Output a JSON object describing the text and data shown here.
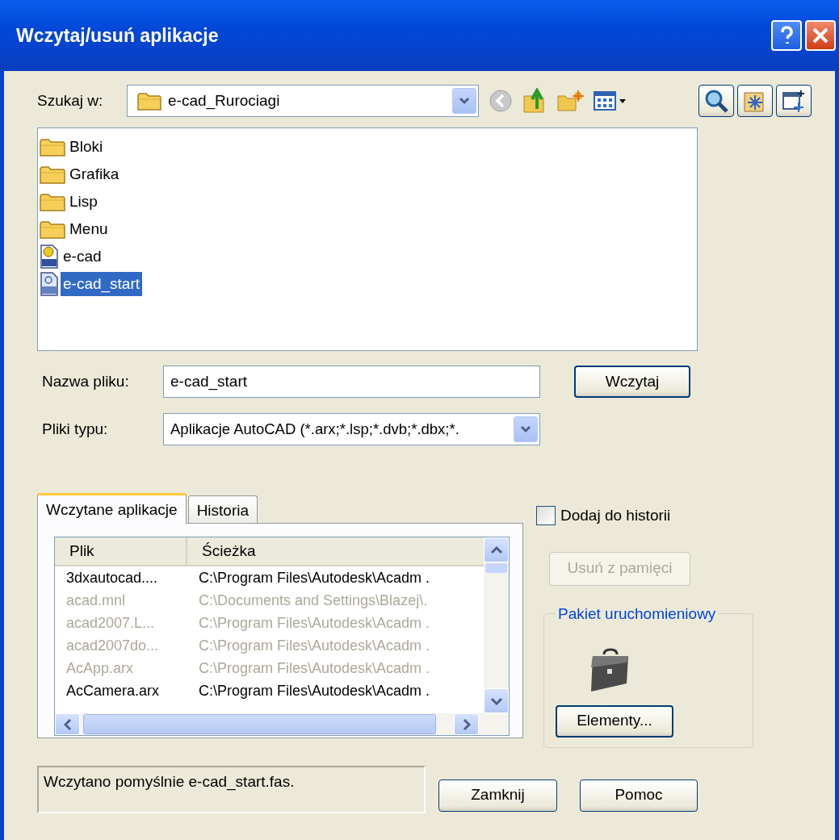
{
  "window": {
    "title": "Wczytaj/usuń aplikacje"
  },
  "look_in": {
    "label": "Szukaj w:",
    "value": "e-cad_Rurociagi"
  },
  "files": [
    {
      "name": "Bloki",
      "kind": "folder",
      "selected": false
    },
    {
      "name": "Grafika",
      "kind": "folder",
      "selected": false
    },
    {
      "name": "Lisp",
      "kind": "folder",
      "selected": false
    },
    {
      "name": "Menu",
      "kind": "folder",
      "selected": false
    },
    {
      "name": "e-cad",
      "kind": "dvb",
      "selected": false
    },
    {
      "name": "e-cad_start",
      "kind": "fas",
      "selected": true
    }
  ],
  "file_name": {
    "label": "Nazwa pliku:",
    "value": "e-cad_start"
  },
  "load_button": "Wczytaj",
  "file_type": {
    "label": "Pliki typu:",
    "value": "Aplikacje AutoCAD (*.arx;*.lsp;*.dvb;*.dbx;*."
  },
  "tabs": [
    {
      "label": "Wczytane aplikacje",
      "selected": true
    },
    {
      "label": "Historia",
      "selected": false
    }
  ],
  "table": {
    "columns": [
      "Plik",
      "Ścieżka"
    ],
    "rows": [
      {
        "file": "3dxautocad....",
        "path": "C:\\Program Files\\Autodesk\\Acadm .",
        "greyed": false
      },
      {
        "file": "acad.mnl",
        "path": "C:\\Documents and Settings\\Blazej\\.",
        "greyed": true
      },
      {
        "file": "acad2007.L...",
        "path": "C:\\Program Files\\Autodesk\\Acadm .",
        "greyed": true
      },
      {
        "file": "acad2007do...",
        "path": "C:\\Program Files\\Autodesk\\Acadm .",
        "greyed": true
      },
      {
        "file": "AcApp.arx",
        "path": "C:\\Program Files\\Autodesk\\Acadm .",
        "greyed": true
      },
      {
        "file": "AcCamera.arx",
        "path": "C:\\Program Files\\Autodesk\\Acadm .",
        "greyed": false
      }
    ]
  },
  "add_to_history": {
    "label": "Dodaj do historii",
    "checked": false
  },
  "unload_button": {
    "label": "Usuń z pamięci",
    "disabled": true
  },
  "startup_suite": {
    "title": "Pakiet uruchomieniowy",
    "button": "Elementy..."
  },
  "status": "Wczytano pomyślnie e-cad_start.fas.",
  "buttons": [
    "Zamknij",
    "Pomoc"
  ]
}
